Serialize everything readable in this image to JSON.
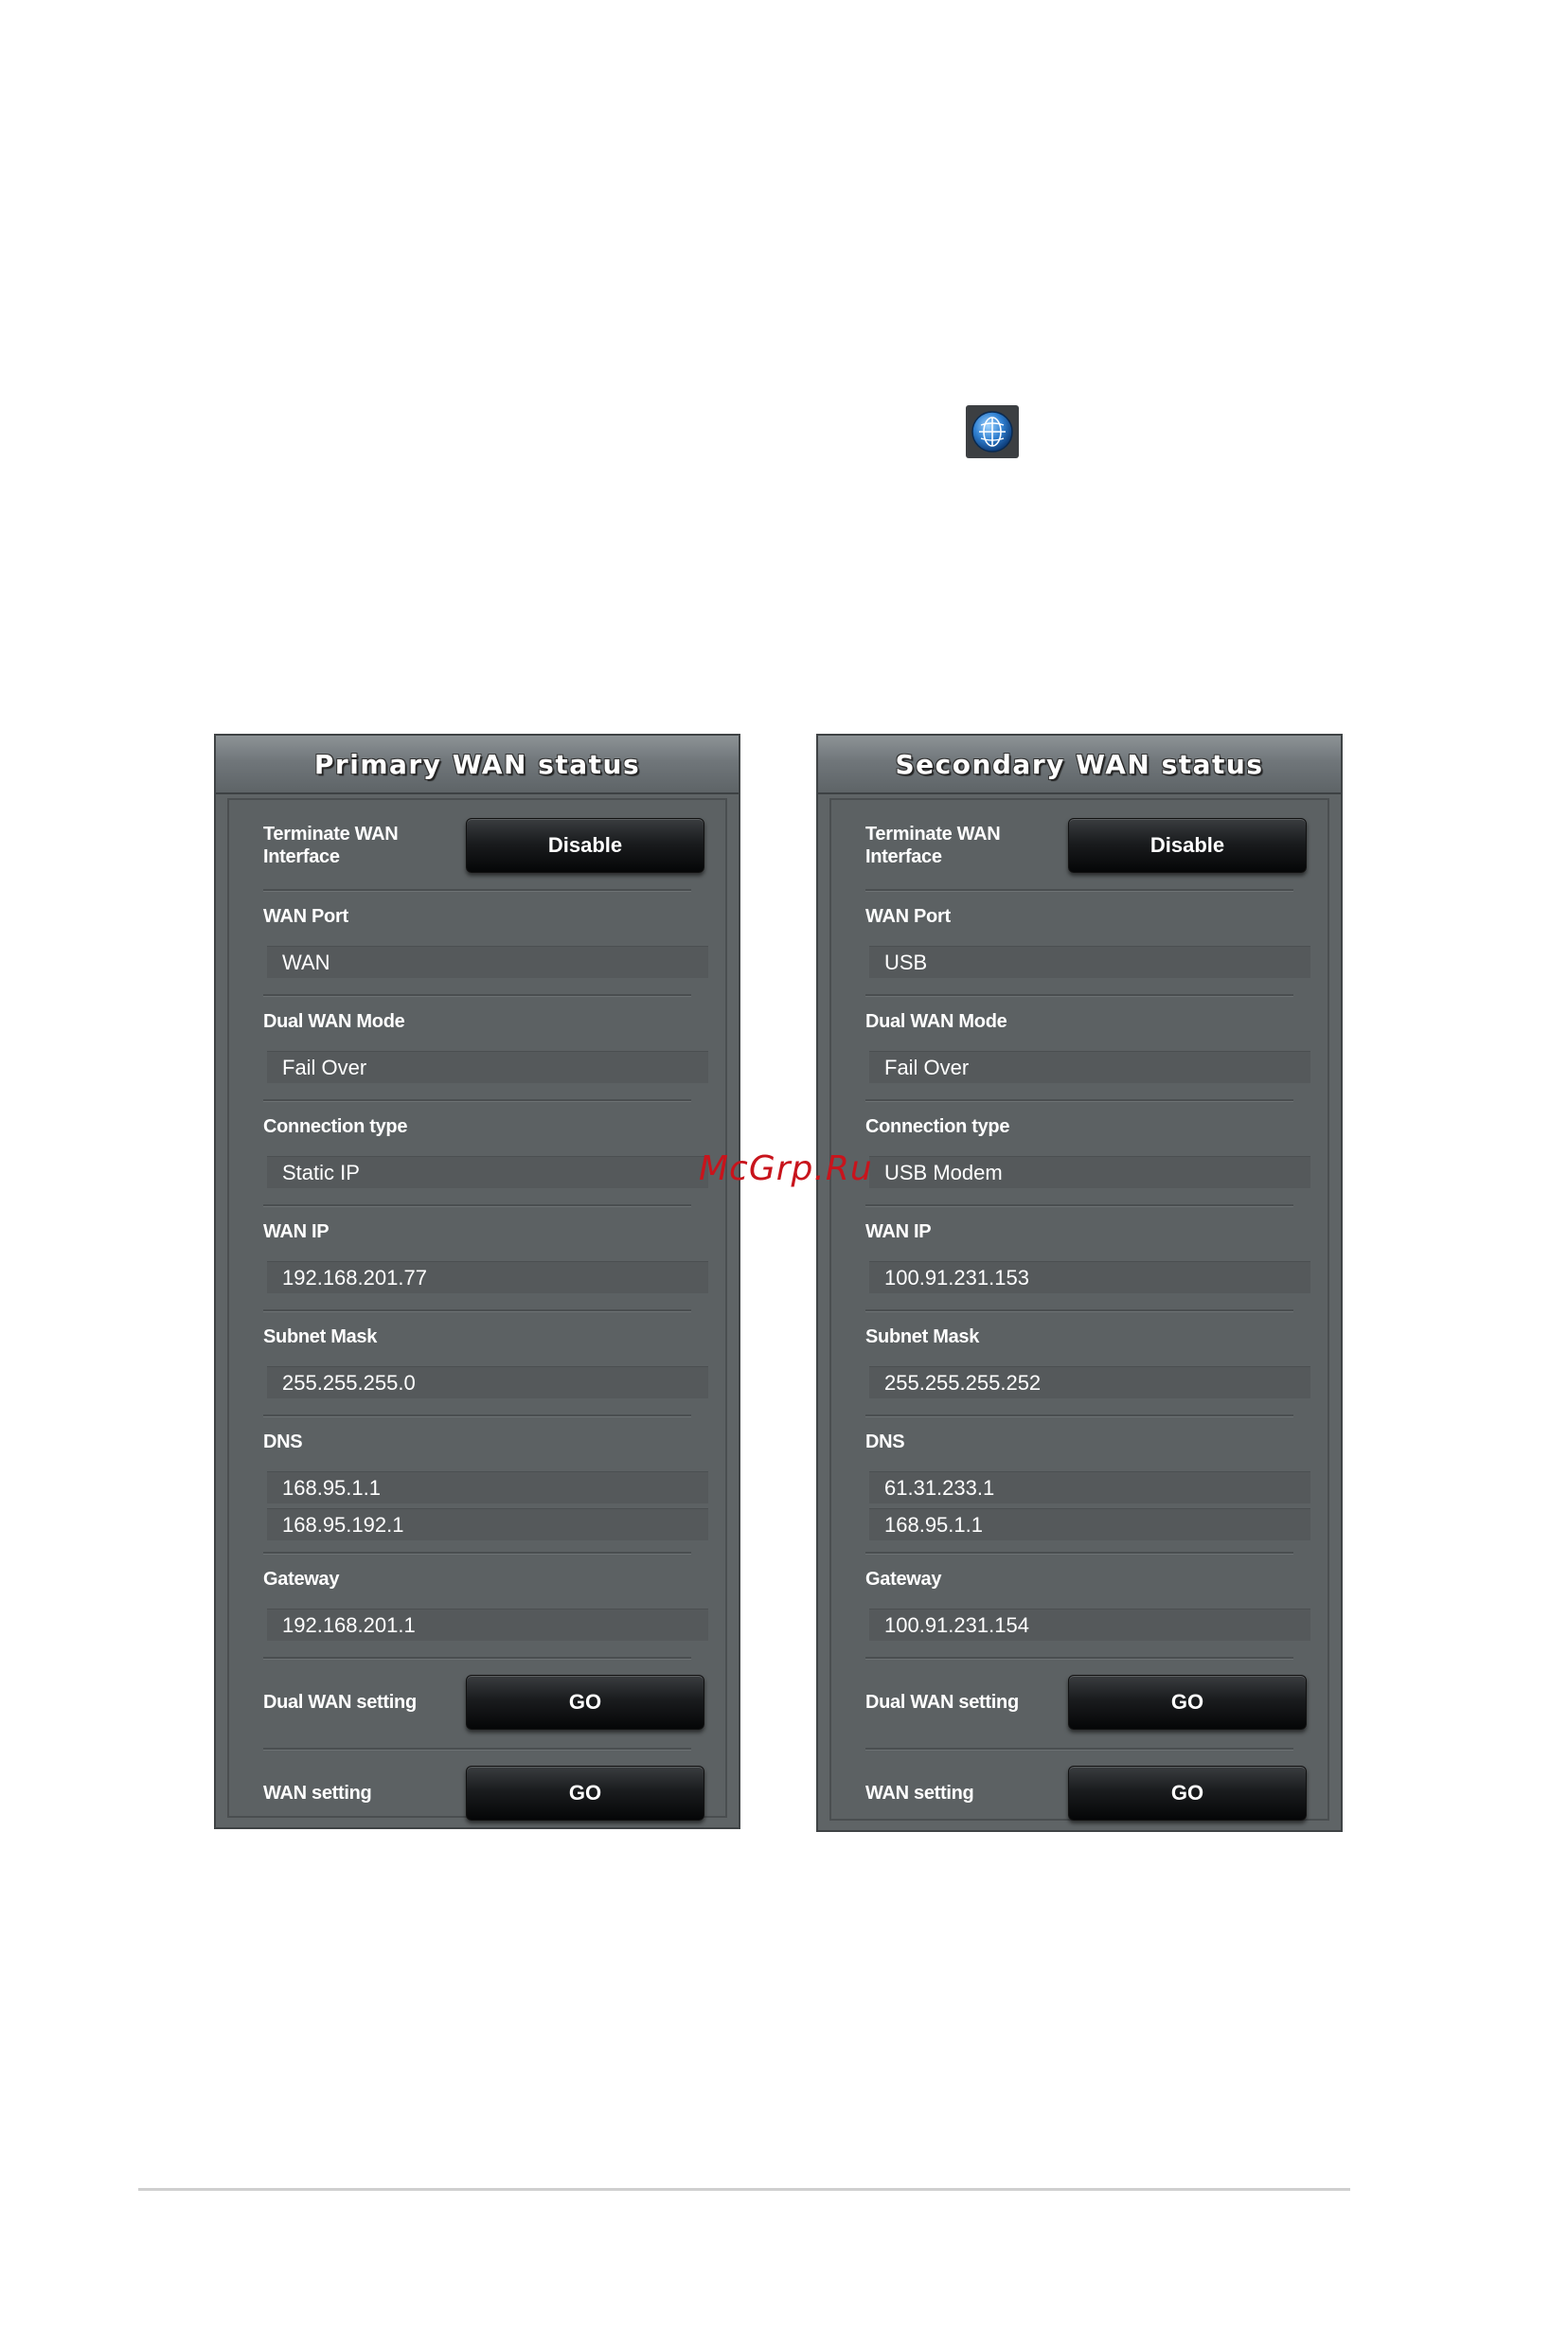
{
  "globe_icon": "globe-icon",
  "watermark": "McGrp.Ru",
  "panels": [
    {
      "title": "Primary WAN status",
      "terminate_label": "Terminate WAN Interface",
      "terminate_button": "Disable",
      "fields": [
        {
          "label": "WAN Port",
          "values": [
            "WAN"
          ]
        },
        {
          "label": "Dual WAN Mode",
          "values": [
            "Fail Over"
          ]
        },
        {
          "label": "Connection type",
          "values": [
            "Static IP"
          ]
        },
        {
          "label": "WAN IP",
          "values": [
            "192.168.201.77"
          ]
        },
        {
          "label": "Subnet Mask",
          "values": [
            "255.255.255.0"
          ]
        },
        {
          "label": "DNS",
          "values": [
            "168.95.1.1",
            "168.95.192.1"
          ]
        },
        {
          "label": "Gateway",
          "values": [
            "192.168.201.1"
          ]
        }
      ],
      "dual_wan_setting_label": "Dual WAN setting",
      "dual_wan_setting_button": "GO",
      "wan_setting_label": "WAN setting",
      "wan_setting_button": "GO"
    },
    {
      "title": "Secondary WAN status",
      "terminate_label": "Terminate WAN Interface",
      "terminate_button": "Disable",
      "fields": [
        {
          "label": "WAN Port",
          "values": [
            "USB"
          ]
        },
        {
          "label": "Dual WAN Mode",
          "values": [
            "Fail Over"
          ]
        },
        {
          "label": "Connection type",
          "values": [
            "USB Modem"
          ]
        },
        {
          "label": "WAN IP",
          "values": [
            "100.91.231.153"
          ]
        },
        {
          "label": "Subnet Mask",
          "values": [
            "255.255.255.252"
          ]
        },
        {
          "label": "DNS",
          "values": [
            "61.31.233.1",
            "168.95.1.1"
          ]
        },
        {
          "label": "Gateway",
          "values": [
            "100.91.231.154"
          ]
        }
      ],
      "dual_wan_setting_label": "Dual WAN setting",
      "dual_wan_setting_button": "GO",
      "wan_setting_label": "WAN setting",
      "wan_setting_button": "GO"
    }
  ],
  "colors": {
    "panel_bg": "#5f6466",
    "field_bg": "#55595b",
    "button_bg": "#111315",
    "watermark": "#c8141c"
  }
}
